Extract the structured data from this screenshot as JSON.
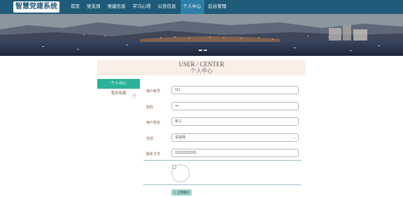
{
  "header": {
    "logo": "智慧党建系统",
    "nav": [
      "首页",
      "党支部",
      "党建信息",
      "学习心得",
      "公告信息",
      "个人中心",
      "后台管理"
    ],
    "active_index": 5
  },
  "banner": {
    "slide_count": 2,
    "active_slide": 1
  },
  "title": {
    "en": "USER / CENTER",
    "cn": "个人中心"
  },
  "side_menu": {
    "items": [
      "个人中心",
      "我的收藏"
    ],
    "active_index": 0
  },
  "form": {
    "account_label": "用户帐号",
    "account_value": "111",
    "password_label": "密码",
    "password_value": "•••",
    "name_label": "用户姓名",
    "name_value": "张三",
    "gender_label": "性别",
    "gender_value": "请选择",
    "phone_label": "联系方式",
    "phone_value": "13233333333",
    "upload_label": "上传图片"
  },
  "colors": {
    "nav_bg": "#1f5a78",
    "accent": "#2bb39a",
    "title_bg": "#fbeee6"
  }
}
